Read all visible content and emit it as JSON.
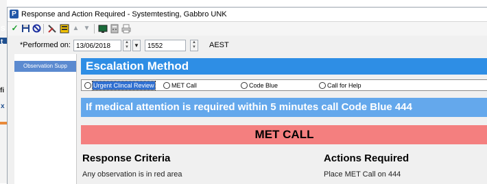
{
  "window": {
    "app_icon_letter": "P",
    "title": "Response and Action Required - Systemtesting, Gabbro  UNK"
  },
  "background": {
    "fragments": [
      "S",
      "t",
      "fi",
      "x"
    ]
  },
  "toolbar": {
    "icons": [
      "checkmark-icon",
      "save-icon",
      "cancel-icon",
      "tools-icon",
      "form-icon",
      "arrow-up-icon",
      "arrow-down-icon",
      "monitor-icon",
      "calculator-icon",
      "print-icon"
    ]
  },
  "performed": {
    "label": "*Performed on:",
    "date": "13/06/2018",
    "time": "1552",
    "timezone": "AEST"
  },
  "sidebar": {
    "items": [
      {
        "label": "Observation Supp"
      }
    ]
  },
  "escalation": {
    "heading": "Escalation Method",
    "options": [
      {
        "label": "Urgent Clincal Review",
        "selected": true
      },
      {
        "label": "MET Call",
        "selected": false
      },
      {
        "label": "Code Blue",
        "selected": false
      },
      {
        "label": "Call for Help",
        "selected": false
      }
    ]
  },
  "alert": {
    "text": "If medical attention is required within 5 minutes call Code Blue 444"
  },
  "met_call": {
    "label": "MET CALL"
  },
  "response": {
    "heading": "Response Criteria",
    "first_line": "Any observation is in red area"
  },
  "actions": {
    "heading": "Actions Required",
    "first_line": "Place MET Call on 444"
  },
  "colors": {
    "header_blue": "#2e8ee5",
    "alert_blue": "#64a8ec",
    "met_red": "#f47f7f",
    "selected_blue": "#5b8ad0"
  }
}
